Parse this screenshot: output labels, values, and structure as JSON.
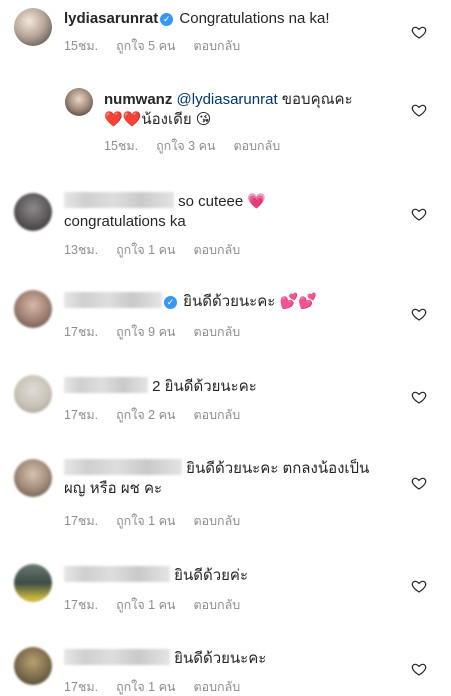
{
  "comments": [
    {
      "username": "lydiasarunrat",
      "verified": true,
      "text": "Congratulations na ka!",
      "time": "15ชม.",
      "likes": "ถูกใจ 5 คน",
      "reply": "ตอบกลับ"
    },
    {
      "username": "numwanz",
      "mention": "@lydiasarunrat",
      "text": "ขอบคุณคะ",
      "hearts": "❤️❤️",
      "text2": "น้องเดีย",
      "emoji": "😘",
      "time": "15ชม.",
      "likes": "ถูกใจ 3 คน",
      "reply": "ตอบกลับ"
    },
    {
      "text": "so cuteee",
      "emoji": "💗",
      "text2": "congratulations ka",
      "time": "13ชม.",
      "likes": "ถูกใจ 1 คน",
      "reply": "ตอบกลับ"
    },
    {
      "verified": true,
      "text": "ยินดีด้วยนะคะ",
      "emoji": "💕💕",
      "time": "17ชม.",
      "likes": "ถูกใจ 9 คน",
      "reply": "ตอบกลับ"
    },
    {
      "text": "2 ยินดีด้วยนะคะ",
      "time": "17ชม.",
      "likes": "ถูกใจ 2 คน",
      "reply": "ตอบกลับ"
    },
    {
      "text": "ยินดีด้วยนะคะ ตกลงน้องเป็น",
      "text2": "ผญ หรือ ผช คะ",
      "time": "17ชม.",
      "likes": "ถูกใจ 1 คน",
      "reply": "ตอบกลับ"
    },
    {
      "text": "ยินดีด้วยค่ะ",
      "time": "17ชม.",
      "likes": "ถูกใจ 1 คน",
      "reply": "ตอบกลับ"
    },
    {
      "text": "ยินดีด้วยนะคะ",
      "time": "17ชม.",
      "likes": "ถูกใจ 1 คน",
      "reply": "ตอบกลับ"
    }
  ]
}
